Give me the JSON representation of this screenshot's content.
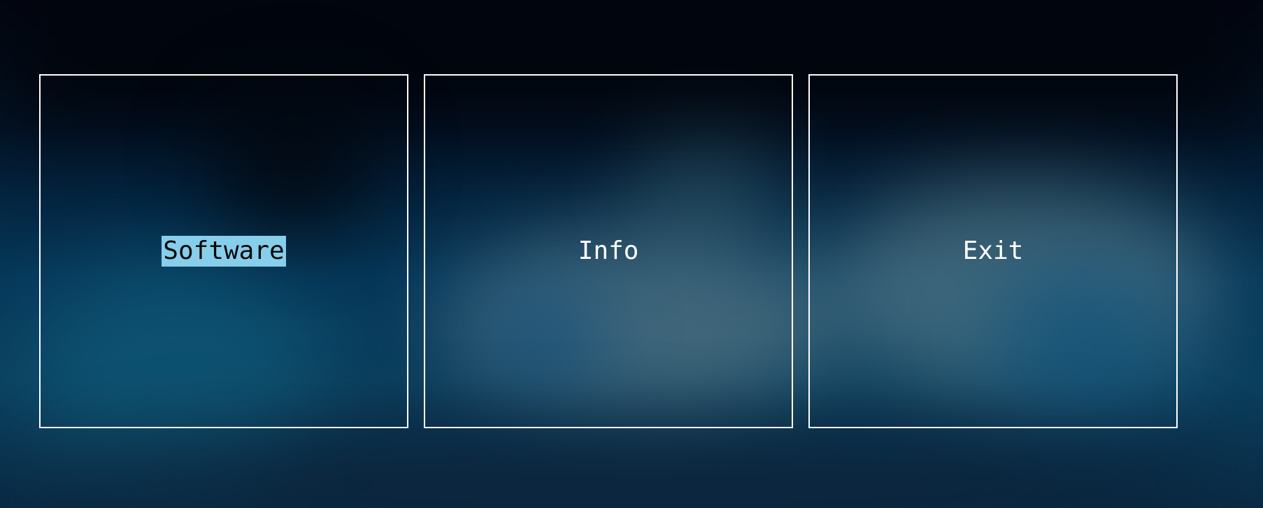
{
  "theme": {
    "border_color": "#ffffff",
    "text_color": "#ffffff",
    "highlight_background": "#87ceeb",
    "highlight_text_color": "#0a0a0a"
  },
  "menu": {
    "selected_index": 0,
    "items": [
      {
        "label": "Software",
        "selected": true
      },
      {
        "label": "Info",
        "selected": false
      },
      {
        "label": "Exit",
        "selected": false
      }
    ]
  }
}
